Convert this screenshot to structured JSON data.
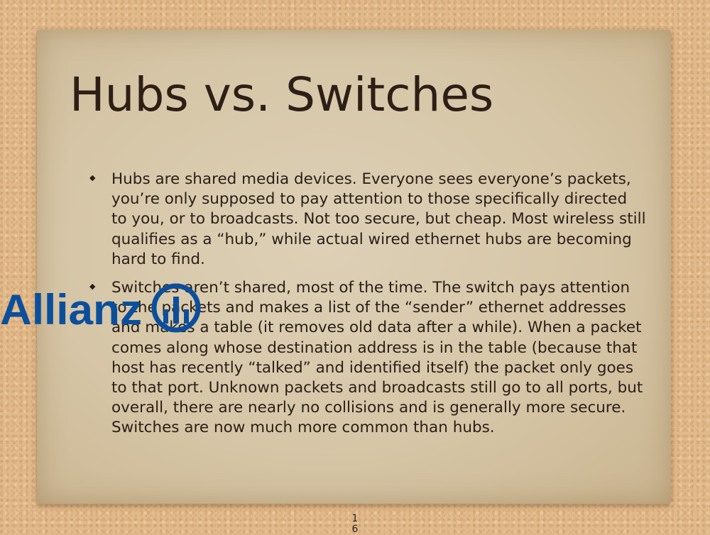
{
  "slide": {
    "title": "Hubs vs. Switches",
    "bullets": [
      "Hubs are shared media devices. Everyone sees everyone’s packets, you’re only supposed to pay attention to those specifically directed to you, or to broadcasts. Not too secure, but cheap. Most wireless still qualifies as a “hub,” while actual wired ethernet hubs are becoming hard to find.",
      "Switches aren’t shared, most of the time. The switch pays attention to the packets and makes a list of the “sender” ethernet addresses and makes a table (it removes old data after a while). When a packet comes along whose destination address is in the table (because that host has recently “talked” and identified itself) the packet only goes to that port. Unknown packets and broadcasts still go to all ports, but overall, there are nearly no collisions and is generally more secure. Switches are now much more common than hubs."
    ],
    "bullet_symbol": "◆",
    "page_number": "16"
  },
  "watermark": {
    "text": "Allianz",
    "color": "#0b4f9c"
  }
}
